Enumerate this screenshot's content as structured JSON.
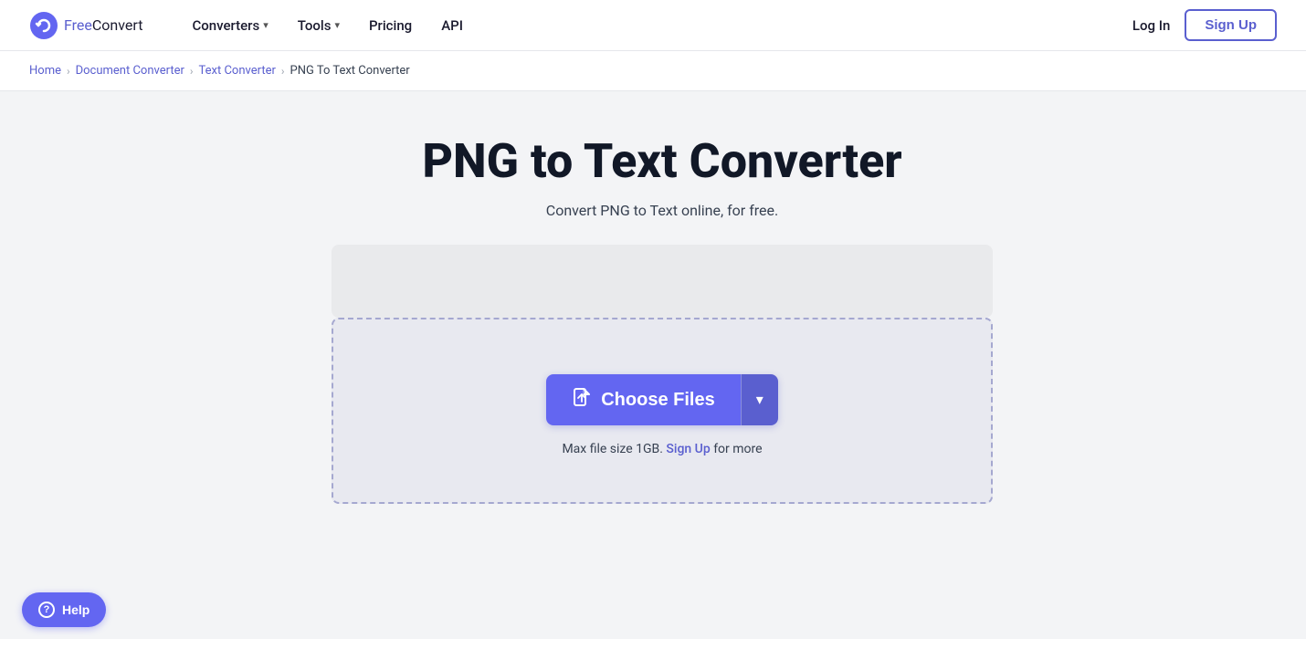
{
  "header": {
    "logo_free": "Free",
    "logo_convert": "Convert",
    "nav": [
      {
        "label": "Converters",
        "has_dropdown": true
      },
      {
        "label": "Tools",
        "has_dropdown": true
      },
      {
        "label": "Pricing",
        "has_dropdown": false
      },
      {
        "label": "API",
        "has_dropdown": false
      }
    ],
    "login_label": "Log In",
    "signup_label": "Sign Up"
  },
  "breadcrumb": {
    "items": [
      {
        "label": "Home",
        "link": true
      },
      {
        "label": "Document Converter",
        "link": true
      },
      {
        "label": "Text Converter",
        "link": true
      },
      {
        "label": "PNG To Text Converter",
        "link": false
      }
    ]
  },
  "main": {
    "title": "PNG to Text Converter",
    "subtitle": "Convert PNG to Text online, for free.",
    "choose_files_label": "Choose Files",
    "file_size_note": "Max file size 1GB.",
    "file_size_link": "Sign Up",
    "file_size_more": " for more"
  },
  "help": {
    "label": "Help"
  },
  "icons": {
    "logo": "↻",
    "chevron_down": "▾",
    "file_upload": "📄",
    "chevron_dropdown": "▾",
    "help_circle": "?"
  }
}
